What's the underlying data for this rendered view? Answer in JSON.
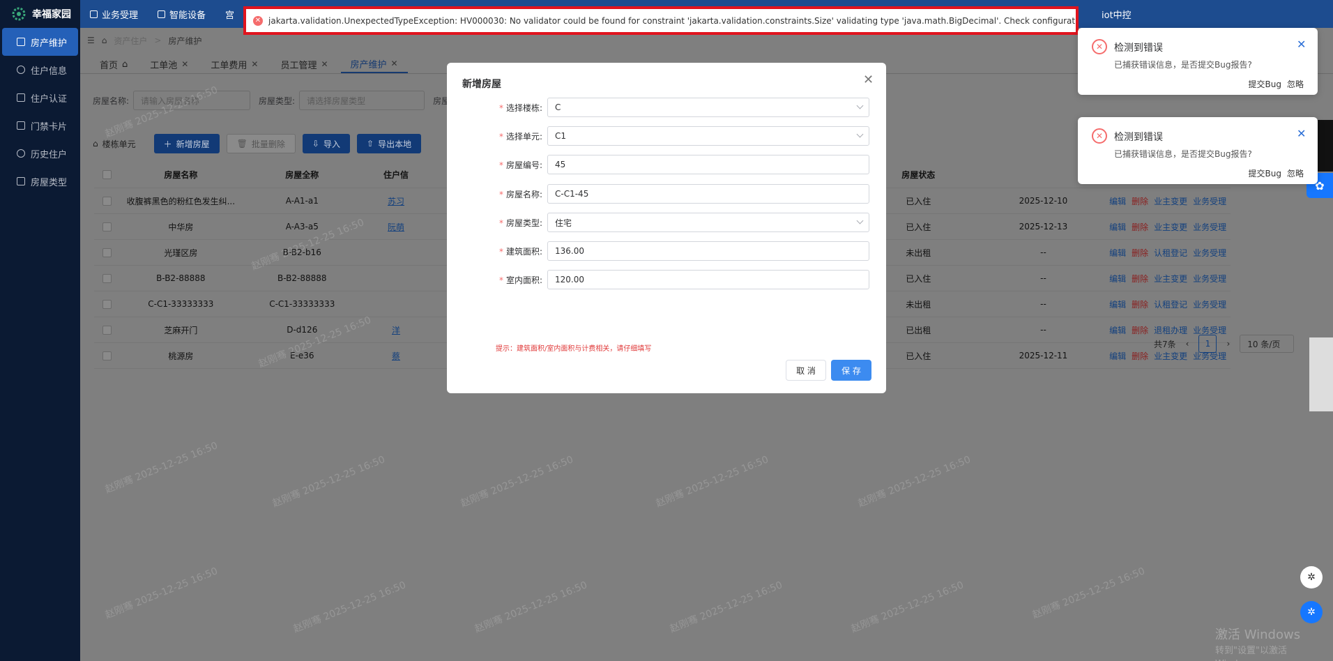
{
  "app": {
    "name": "幸福家园"
  },
  "sidebar": {
    "items": [
      {
        "label": "房产维护",
        "active": true
      },
      {
        "label": "住户信息"
      },
      {
        "label": "住户认证"
      },
      {
        "label": "门禁卡片"
      },
      {
        "label": "历史住户"
      },
      {
        "label": "房屋类型"
      }
    ]
  },
  "topnav": {
    "items": [
      "业务受理",
      "智能设备",
      "宫"
    ],
    "right": "iot中控"
  },
  "breadcrumb": {
    "parent": "资产住户",
    "current": "房产维护"
  },
  "tabs": [
    {
      "label": "首页"
    },
    {
      "label": "工单池"
    },
    {
      "label": "工单费用"
    },
    {
      "label": "员工管理"
    },
    {
      "label": "房产维护",
      "active": true
    }
  ],
  "filter": {
    "name_label": "房屋名称:",
    "name_placeholder": "请输入房屋名称",
    "type_label": "房屋类型:",
    "type_placeholder": "请选择房屋类型",
    "extra_label": "房屋"
  },
  "toolbar": {
    "tree_label": "楼栋单元",
    "add": "新增房屋",
    "batch_delete": "批量删除",
    "import": "导入",
    "export": "导出本地"
  },
  "table": {
    "headers": {
      "name": "房屋名称",
      "full": "房屋全称",
      "resident": "住户信",
      "state": "房屋状态"
    },
    "rows": [
      {
        "name": "收腹裤黑色的粉红色发生纠...",
        "full": "A-A1-a1",
        "resident": "苏习",
        "state": "已入住",
        "date": "2025-12-10",
        "ops": [
          "编辑",
          "删除",
          "业主变更",
          "业务受理"
        ]
      },
      {
        "name": "中华房",
        "full": "A-A3-a5",
        "resident": "阮萌",
        "state": "已入住",
        "date": "2025-12-13",
        "ops": [
          "编辑",
          "删除",
          "业主变更",
          "业务受理"
        ]
      },
      {
        "name": "光瑾区房",
        "full": "B-B2-b16",
        "resident": "",
        "state": "未出租",
        "date": "--",
        "ops": [
          "编辑",
          "删除",
          "认租登记",
          "业务受理"
        ]
      },
      {
        "name": "B-B2-88888",
        "full": "B-B2-88888",
        "resident": "",
        "state": "已入住",
        "date": "--",
        "ops": [
          "编辑",
          "删除",
          "业主变更",
          "业务受理"
        ]
      },
      {
        "name": "C-C1-33333333",
        "full": "C-C1-33333333",
        "resident": "",
        "state": "未出租",
        "date": "--",
        "ops": [
          "编辑",
          "删除",
          "认租登记",
          "业务受理"
        ]
      },
      {
        "name": "芝麻开门",
        "full": "D-d126",
        "resident": "洋",
        "state": "已出租",
        "date": "--",
        "ops": [
          "编辑",
          "删除",
          "退租办理",
          "业务受理"
        ]
      },
      {
        "name": "桃源房",
        "full": "E-e36",
        "resident": "蔡",
        "state": "已入住",
        "date": "2025-12-11",
        "ops": [
          "编辑",
          "删除",
          "业主变更",
          "业务受理"
        ]
      }
    ]
  },
  "pager": {
    "total": "共7条",
    "page": "1",
    "size": "10 条/页"
  },
  "error_bar": {
    "text": "jakarta.validation.UnexpectedTypeException: HV000030: No validator could be found for constraint 'jakarta.validation.constraints.Size' validating type 'java.math.BigDecimal'. Check configuration for 'builtUpArea'"
  },
  "notifications": [
    {
      "title": "检测到错误",
      "body": "已捕获错误信息，是否提交Bug报告?",
      "submit": "提交Bug",
      "ignore": "忽略"
    },
    {
      "title": "检测到错误",
      "body": "已捕获错误信息，是否提交Bug报告?",
      "submit": "提交Bug",
      "ignore": "忽略"
    }
  ],
  "modal": {
    "title": "新增房屋",
    "fields": [
      {
        "label": "选择楼栋:",
        "value": "C",
        "type": "select"
      },
      {
        "label": "选择单元:",
        "value": "C1",
        "type": "select"
      },
      {
        "label": "房屋编号:",
        "value": "45",
        "type": "input"
      },
      {
        "label": "房屋名称:",
        "value": "C-C1-45",
        "type": "input"
      },
      {
        "label": "房屋类型:",
        "value": "住宅",
        "type": "select"
      },
      {
        "label": "建筑面积:",
        "value": "136.00",
        "type": "input"
      },
      {
        "label": "室内面积:",
        "value": "120.00",
        "type": "input"
      }
    ],
    "hint": "提示：建筑面积/室内面积与计费相关，请仔细填写",
    "cancel": "取 消",
    "save": "保 存"
  },
  "watermark": "赵刚骞 2025-12-25 16:50",
  "windows": {
    "line1": "激活 Windows",
    "line2": "转到\"设置\"以激活 Windows。"
  },
  "colors": {
    "primary": "#409eff",
    "danger": "#f56c6c",
    "error_border": "#e0141e",
    "sidebar": "#0b1a33"
  }
}
